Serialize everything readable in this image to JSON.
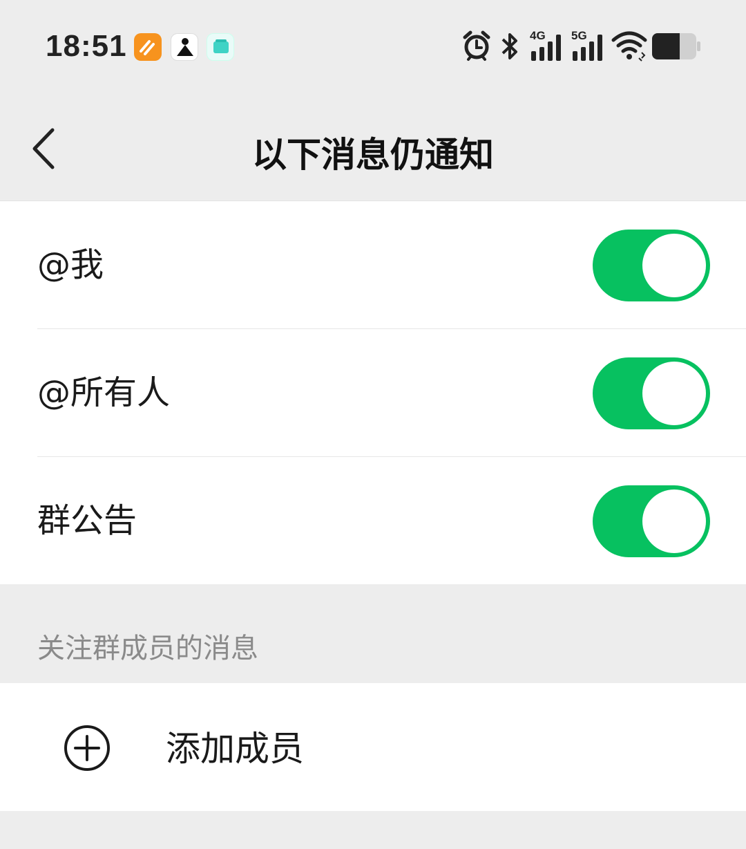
{
  "status_bar": {
    "time": "18:51",
    "network_4g": "4G",
    "network_5g": "5G",
    "icons": [
      "orange-app-icon",
      "person-app-icon",
      "teal-app-icon",
      "alarm-icon",
      "bluetooth-icon",
      "signal-4g-icon",
      "signal-5g-icon",
      "wifi-icon",
      "battery-icon"
    ]
  },
  "nav": {
    "title": "以下消息仍通知",
    "back_icon": "chevron-left-icon"
  },
  "toggles": [
    {
      "label": "@我",
      "on": true
    },
    {
      "label": "@所有人",
      "on": true
    },
    {
      "label": "群公告",
      "on": true
    }
  ],
  "members_section": {
    "title": "关注群成员的消息",
    "add_label": "添加成员",
    "add_icon": "plus-circle-icon"
  },
  "colors": {
    "accent": "#07c160",
    "background": "#ededed",
    "card": "#ffffff"
  }
}
